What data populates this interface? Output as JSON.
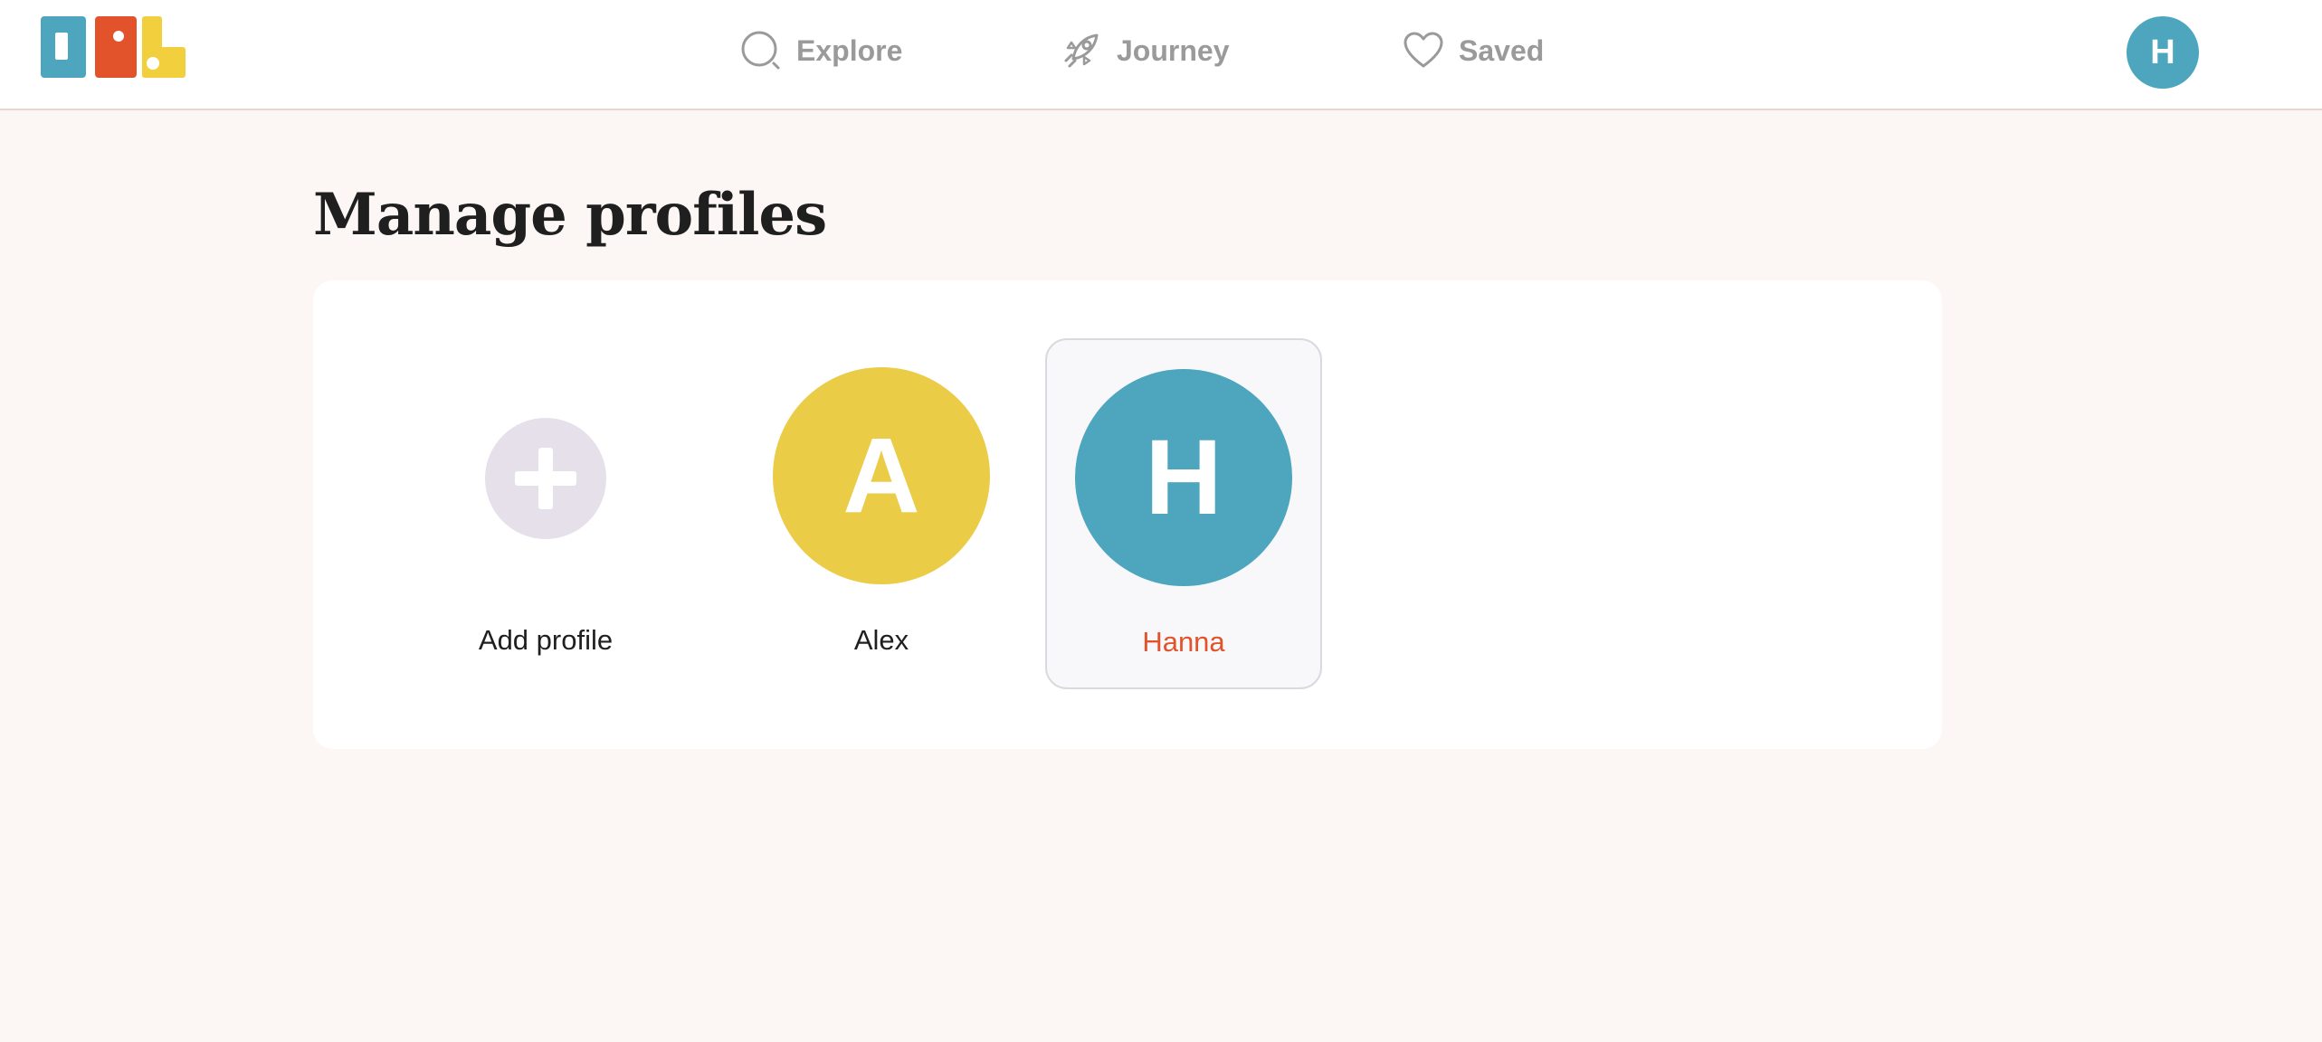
{
  "nav": {
    "explore_label": "Explore",
    "journey_label": "Journey",
    "saved_label": "Saved",
    "user_initial": "H"
  },
  "page": {
    "title": "Manage profiles"
  },
  "profiles": {
    "add_label": "Add profile",
    "items": [
      {
        "initial": "A",
        "name": "Alex",
        "color": "#ebcc47"
      },
      {
        "initial": "H",
        "name": "Hanna",
        "color": "#4da6bd",
        "selected": true
      }
    ]
  },
  "colors": {
    "accent": "#e2532b",
    "logo_blue": "#4da6bd",
    "logo_orange": "#e2532b",
    "logo_yellow": "#f2cf3c"
  }
}
